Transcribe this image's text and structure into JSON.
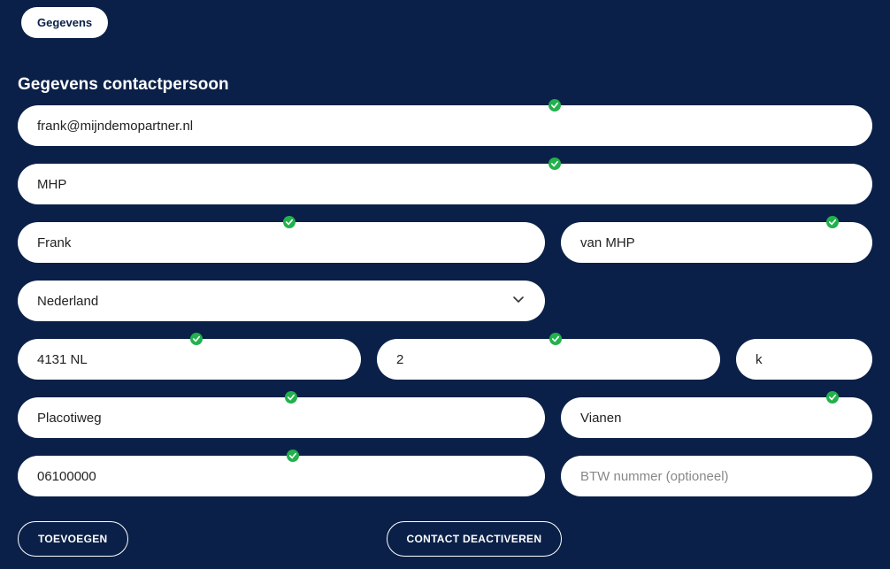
{
  "tab": {
    "label": "Gegevens"
  },
  "section": {
    "title": "Gegevens contactpersoon"
  },
  "fields": {
    "email": {
      "value": "frank@mijndemopartner.nl",
      "valid": true
    },
    "company": {
      "value": "MHP",
      "valid": true
    },
    "firstname": {
      "value": "Frank",
      "valid": true
    },
    "lastname": {
      "value": "van MHP",
      "valid": true
    },
    "country": {
      "value": "Nederland"
    },
    "postal": {
      "value": "4131 NL",
      "valid": true
    },
    "housenr": {
      "value": "2",
      "valid": true
    },
    "suffix": {
      "value": "k"
    },
    "street": {
      "value": "Placotiweg",
      "valid": true
    },
    "city": {
      "value": "Vianen",
      "valid": true
    },
    "phone": {
      "value": "06100000",
      "valid": true
    },
    "vat": {
      "value": "",
      "placeholder": "BTW nummer (optioneel)"
    }
  },
  "buttons": {
    "add": "TOEVOEGEN",
    "deactivate": "CONTACT DEACTIVEREN"
  }
}
